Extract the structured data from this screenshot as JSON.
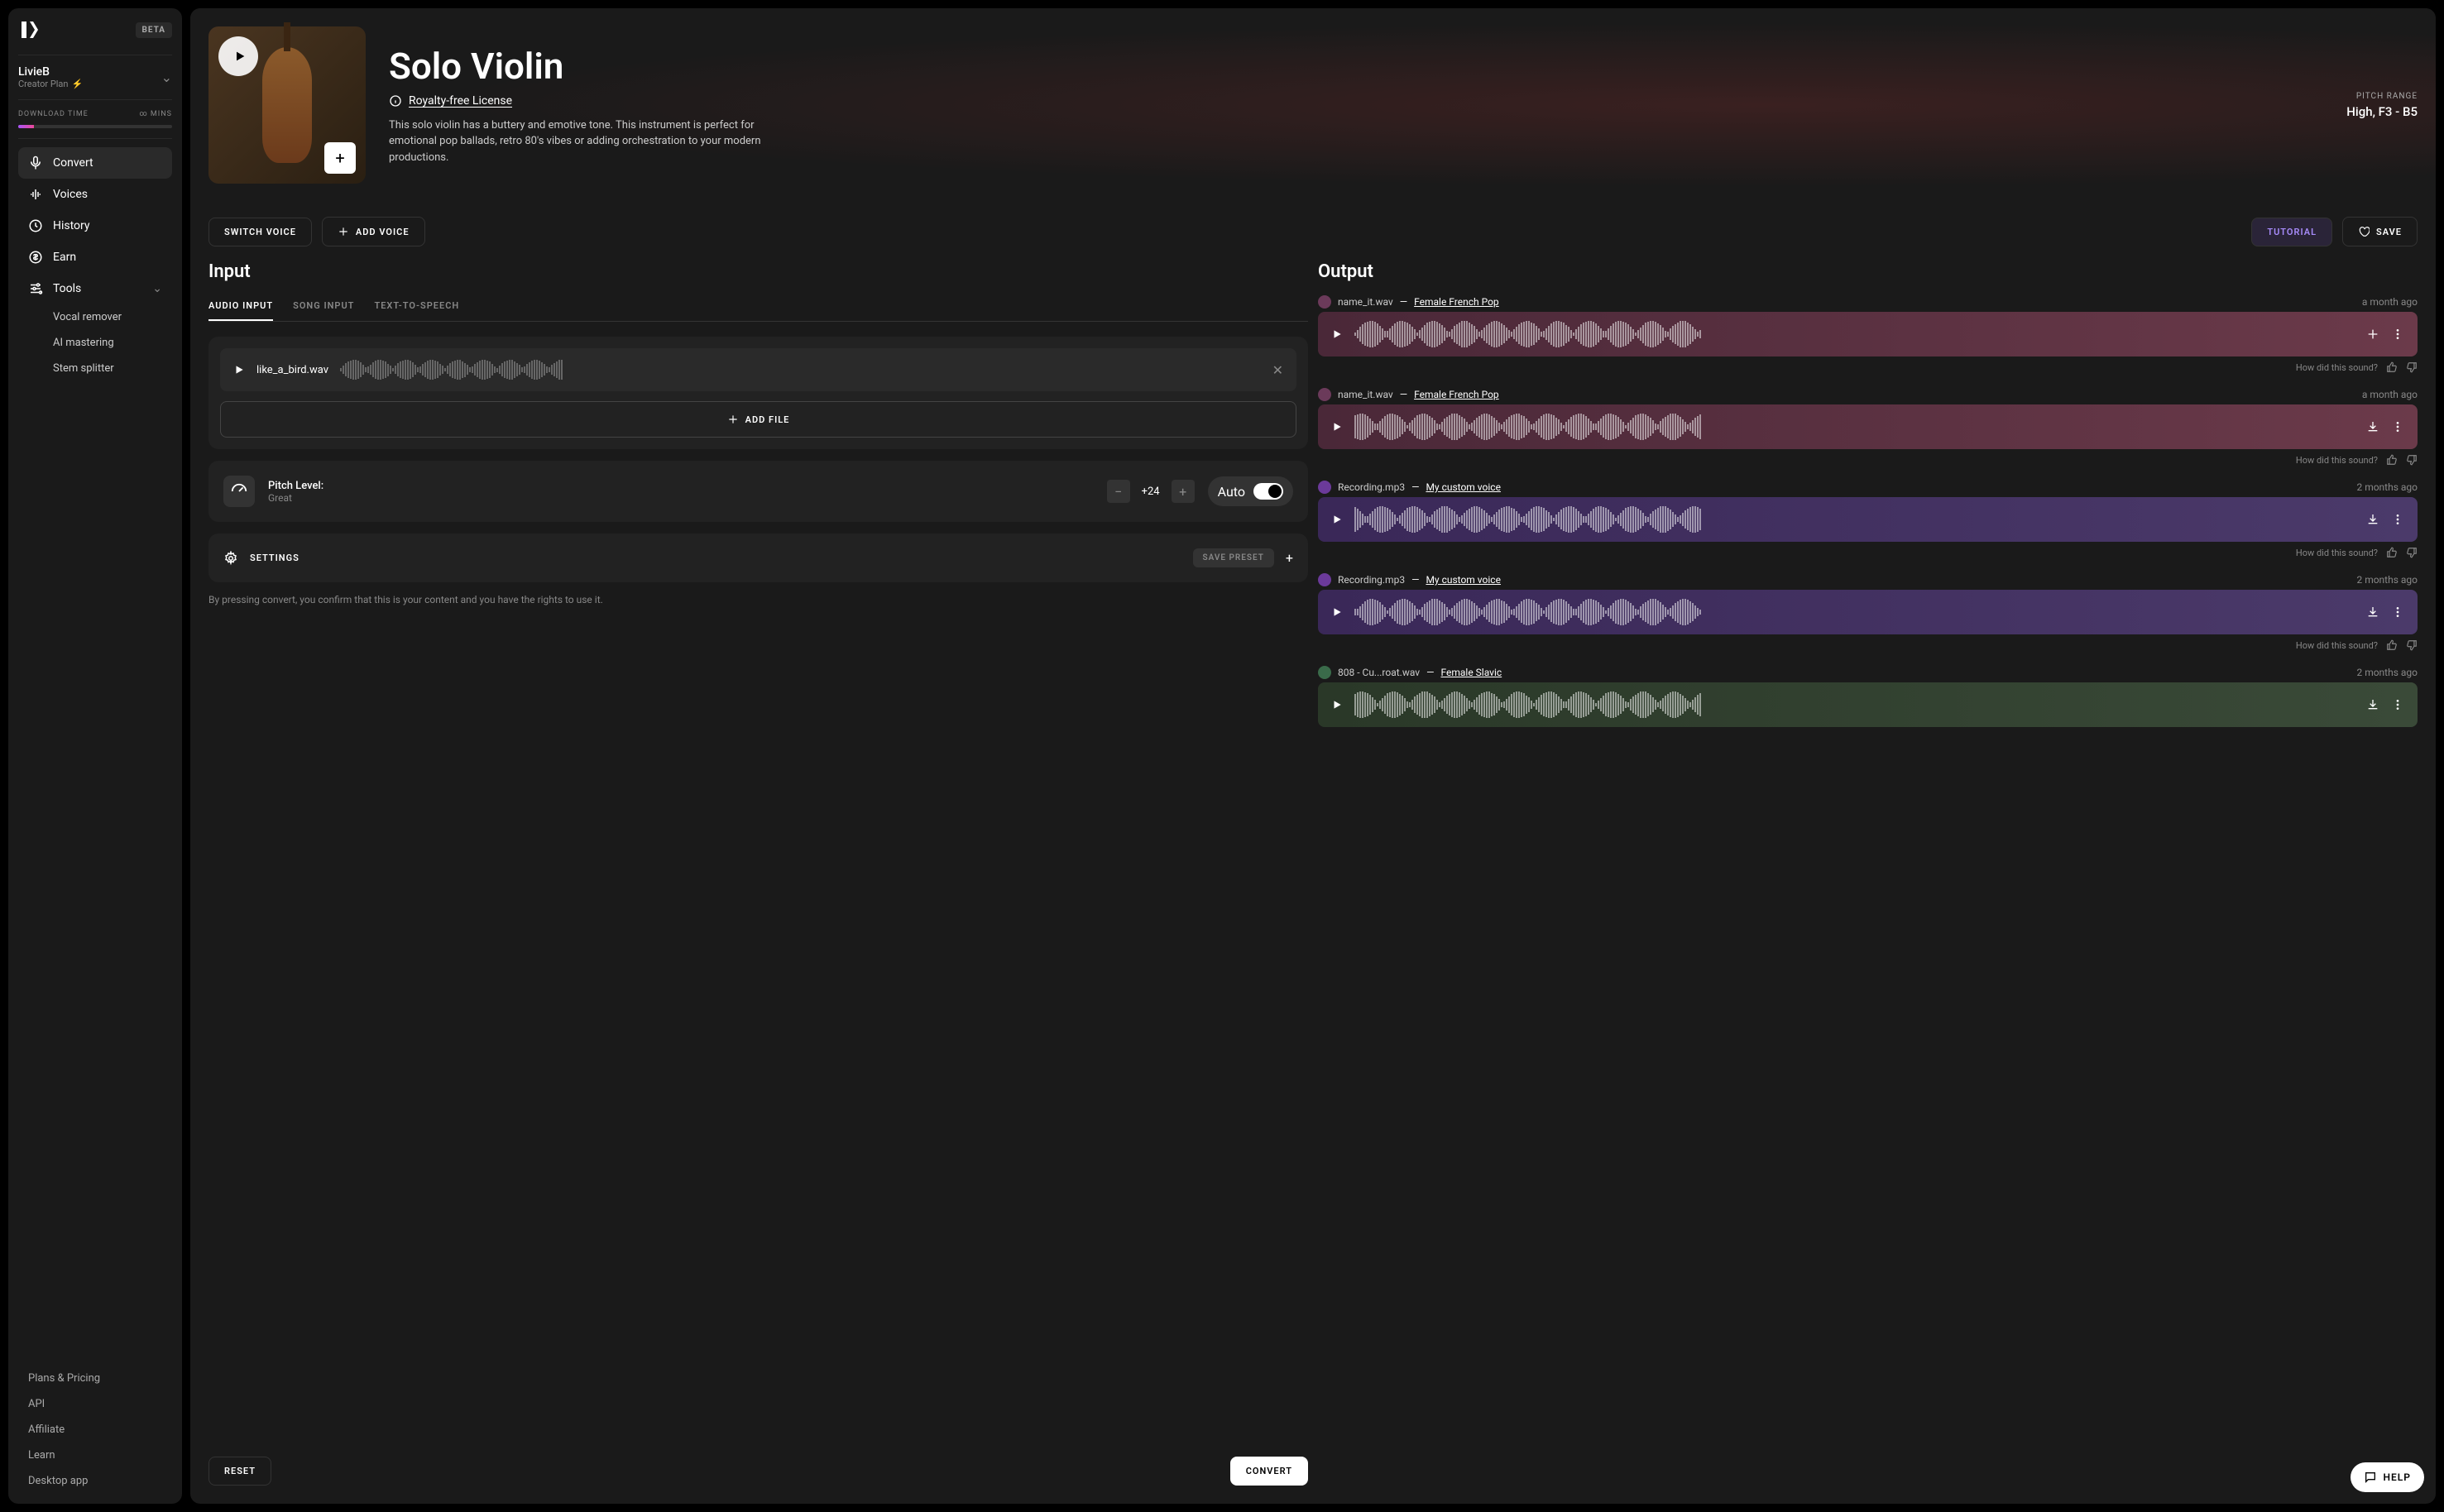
{
  "beta": "BETA",
  "user": {
    "name": "LivieB",
    "plan": "Creator Plan"
  },
  "download": {
    "label": "DOWNLOAD TIME",
    "value": "∞ MINS"
  },
  "nav": {
    "convert": "Convert",
    "voices": "Voices",
    "history": "History",
    "earn": "Earn",
    "tools": "Tools",
    "vocal_remover": "Vocal remover",
    "ai_mastering": "AI mastering",
    "stem_splitter": "Stem splitter"
  },
  "links": {
    "plans": "Plans & Pricing",
    "api": "API",
    "affiliate": "Affiliate",
    "learn": "Learn",
    "desktop": "Desktop app"
  },
  "hero": {
    "title": "Solo Violin",
    "license": "Royalty-free License",
    "desc": "This solo violin has a buttery and emotive tone. This instrument is perfect for emotional pop ballads, retro 80's vibes or adding orchestration to your modern productions.",
    "meta_label": "PITCH RANGE",
    "meta_value": "High, F3 - B5"
  },
  "actions": {
    "switch": "SWITCH VOICE",
    "add_voice": "ADD VOICE",
    "tutorial": "TUTORIAL",
    "save": "SAVE"
  },
  "input": {
    "title": "Input",
    "tabs": {
      "audio": "AUDIO INPUT",
      "song": "SONG INPUT",
      "tts": "TEXT-TO-SPEECH"
    },
    "file": "like_a_bird.wav",
    "add_file": "ADD FILE",
    "pitch_label": "Pitch Level:",
    "pitch_sub": "Great",
    "pitch_value": "+24",
    "auto": "Auto",
    "settings": "SETTINGS",
    "save_preset": "SAVE PRESET",
    "disclaimer": "By pressing convert, you confirm that this is your content and you have the rights to use it.",
    "reset": "RESET",
    "convert": "CONVERT"
  },
  "output": {
    "title": "Output",
    "feedback": "How did this sound?",
    "items": [
      {
        "file": "name_it.wav",
        "sep": " — ",
        "voice": "Female French Pop",
        "time": "a month ago",
        "color": "pink",
        "avatar": "pink",
        "icon": "plus"
      },
      {
        "file": "name_it.wav",
        "sep": " — ",
        "voice": "Female French Pop",
        "time": "a month ago",
        "color": "pink",
        "avatar": "pink",
        "icon": "download"
      },
      {
        "file": "Recording.mp3",
        "sep": " — ",
        "voice": "My custom voice",
        "time": "2 months ago",
        "color": "purple",
        "avatar": "purple",
        "icon": "download"
      },
      {
        "file": "Recording.mp3",
        "sep": " — ",
        "voice": "My custom voice",
        "time": "2 months ago",
        "color": "purple",
        "avatar": "purple",
        "icon": "download"
      },
      {
        "file": "808 - Cu...roat.wav",
        "sep": " — ",
        "voice": "Female Slavic",
        "time": "2 months ago",
        "color": "green",
        "avatar": "green",
        "icon": "download"
      }
    ]
  },
  "help": "HELP"
}
